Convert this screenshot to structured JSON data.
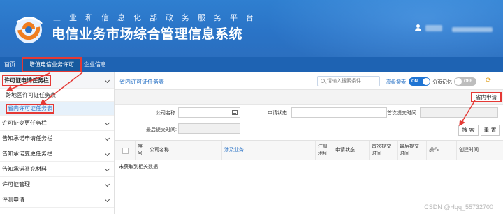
{
  "header": {
    "org_name": "工业和信息化部政务服务平台",
    "system_title": "电信业务市场综合管理信息系统"
  },
  "nav": {
    "items": [
      {
        "label": "首页"
      },
      {
        "label": "增值电信业务许可"
      },
      {
        "label": "企业信息"
      }
    ]
  },
  "sidebar": {
    "items": [
      {
        "label": "许可证申请任务栏"
      },
      {
        "label": "许可证变更任务栏"
      },
      {
        "label": "告知承诺申请任务栏"
      },
      {
        "label": "告知承诺变更任务栏"
      },
      {
        "label": "告知承诺补充材料"
      },
      {
        "label": "许可证管理"
      },
      {
        "label": "评测申请"
      }
    ],
    "subitems": [
      {
        "label": "跨地区许可证任务表"
      },
      {
        "label": "省内许可证任务表"
      }
    ]
  },
  "toolbar": {
    "title": "省内许可证任务表",
    "search_placeholder": "请输入搜索条件",
    "advanced_search": "高级搜索",
    "toggle_on": "ON",
    "page_memory": "分页记忆",
    "toggle_off": "OFF"
  },
  "actions": {
    "provincial_apply": "省内申请"
  },
  "filters": {
    "company_name": "公司名称:",
    "apply_status": "申请状态:",
    "first_submit_time": "首次提交时间:",
    "last_submit_time": "最后提交时间:",
    "search_button": "搜 索",
    "reset_button": "重 置"
  },
  "table": {
    "columns": [
      "序号",
      "公司名称",
      "涉及业务",
      "注册地址",
      "申请状态",
      "首次提交时间",
      "最后提交时间",
      "操作",
      "创建时间"
    ],
    "empty_text": "未获取到相关数据"
  },
  "watermark": "CSDN @Hqq_55732700",
  "colors": {
    "header_blue": "#2a73c6",
    "nav_blue": "#1e63b3",
    "highlight_red": "#e53935",
    "toggle_on": "#1f74d3"
  }
}
